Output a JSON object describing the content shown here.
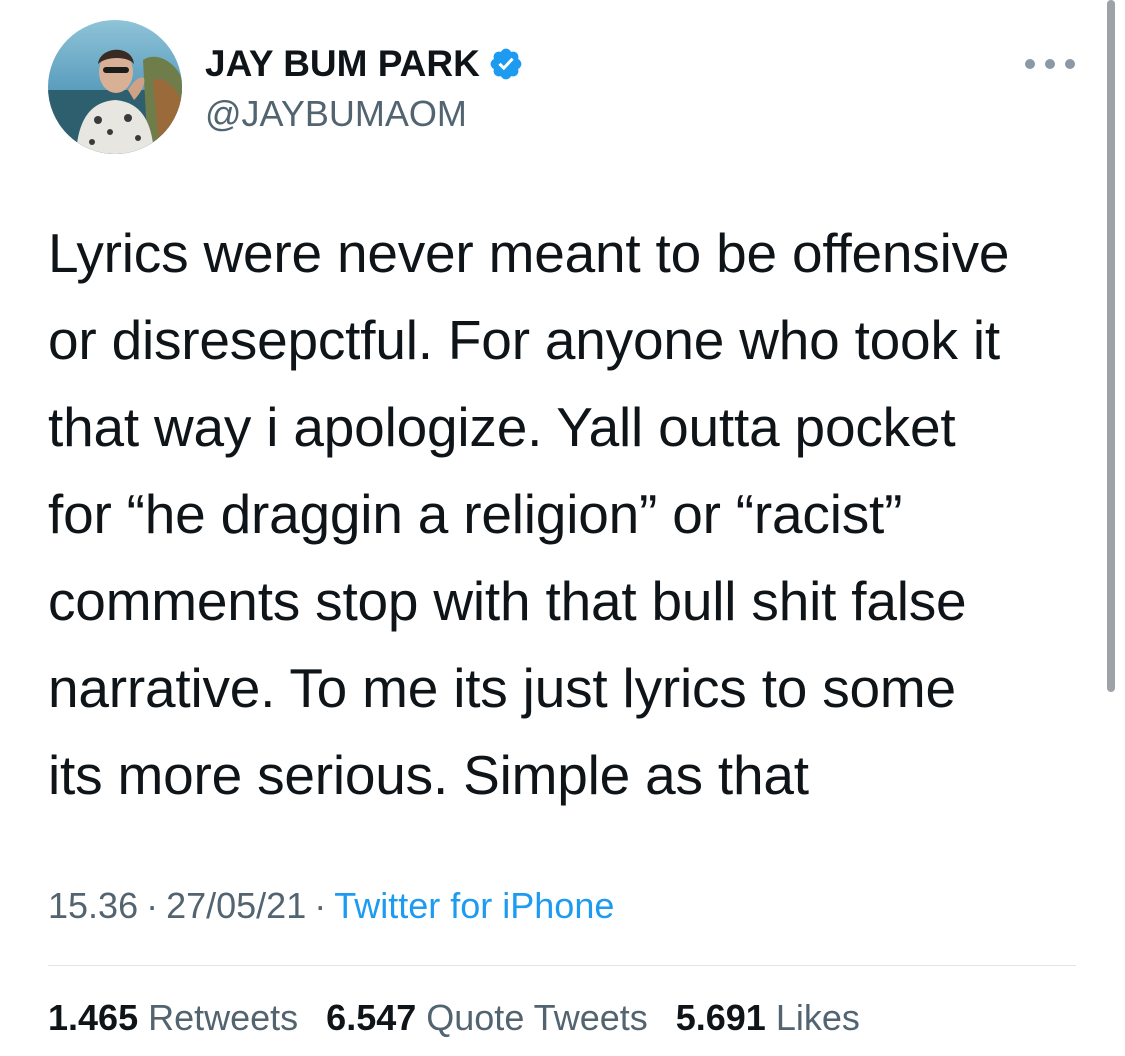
{
  "user": {
    "display_name": "JAY BUM PARK",
    "handle": "@JAYBUMAOM",
    "verified": true
  },
  "tweet": {
    "text_lines": [
      "Lyrics were never meant to be offensive",
      "or disresepctful. For anyone who took it",
      "that way i apologize. Yall outta pocket",
      "for “he draggin a religion” or “racist”",
      "comments stop with that bull shit false",
      "narrative. To me its just lyrics to some",
      "its more serious. Simple as that"
    ],
    "time": "15.36",
    "date": "27/05/21",
    "separator": "·",
    "source": "Twitter for iPhone"
  },
  "stats": {
    "retweets_count": "1.465",
    "retweets_label": "Retweets",
    "quotes_count": "6.547",
    "quotes_label": "Quote Tweets",
    "likes_count": "5.691",
    "likes_label": "Likes"
  },
  "icons": {
    "verified": "verified-badge-icon",
    "more": "more-options-icon"
  },
  "colors": {
    "text": "#0f1419",
    "secondary": "#536471",
    "link": "#1d9bf0",
    "divider": "#e1e4e8"
  }
}
